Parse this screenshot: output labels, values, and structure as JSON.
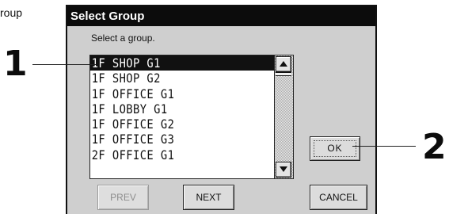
{
  "caption": "roup",
  "dialog": {
    "title": "Select Group",
    "instruction": "Select a group.",
    "list": {
      "items": [
        {
          "label": "1F SHOP G1",
          "selected": true
        },
        {
          "label": "1F SHOP G2",
          "selected": false
        },
        {
          "label": "1F OFFICE G1",
          "selected": false
        },
        {
          "label": "1F LOBBY G1",
          "selected": false
        },
        {
          "label": "1F OFFICE G2",
          "selected": false
        },
        {
          "label": "1F OFFICE G3",
          "selected": false
        },
        {
          "label": "2F OFFICE G1",
          "selected": false
        }
      ]
    },
    "buttons": {
      "ok": "OK",
      "prev": "PREV",
      "next": "NEXT",
      "cancel": "CANCEL"
    }
  },
  "callouts": {
    "one": "1",
    "two": "2"
  },
  "icons": {
    "scroll_up": "triangle-up-icon",
    "scroll_down": "triangle-down-icon"
  },
  "colors": {
    "titlebar": "#0c0c0c",
    "dialog_bg": "#cfcfcf",
    "selection": "#111111"
  }
}
